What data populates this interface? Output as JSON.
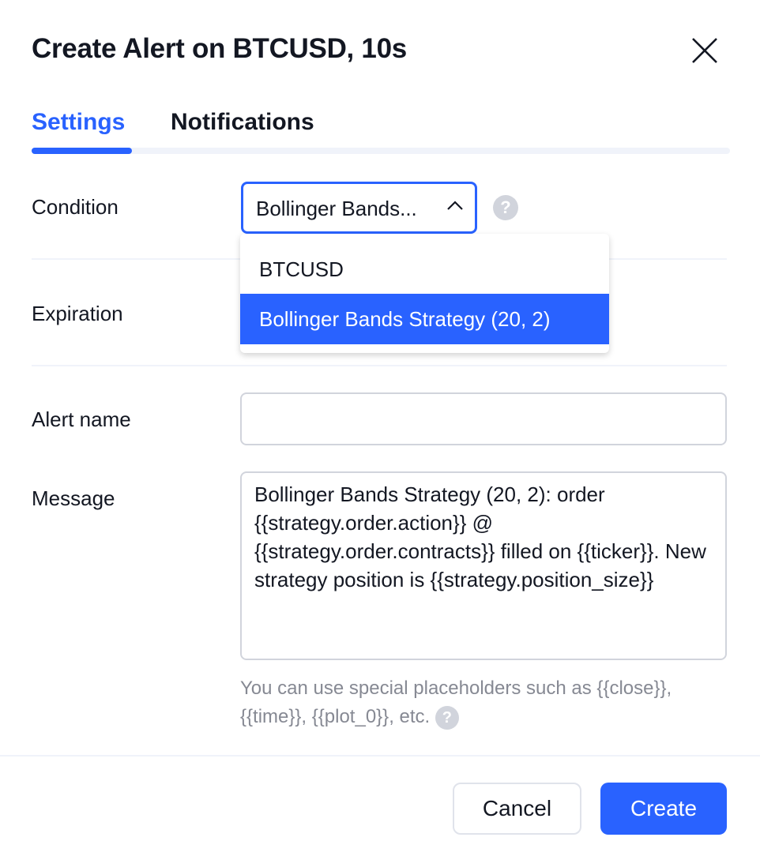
{
  "dialog": {
    "title": "Create Alert on BTCUSD, 10s",
    "close_icon": "close-icon"
  },
  "tabs": [
    {
      "label": "Settings",
      "active": true
    },
    {
      "label": "Notifications",
      "active": false
    }
  ],
  "accent_color": "#2962ff",
  "condition": {
    "label": "Condition",
    "selected": "Bollinger Bands...",
    "options": [
      "BTCUSD",
      "Bollinger Bands Strategy (20, 2)"
    ],
    "highlighted_option": "Bollinger Bands Strategy (20, 2)",
    "help": "?"
  },
  "expiration": {
    "label": "Expiration"
  },
  "alert_name": {
    "label": "Alert name",
    "value": ""
  },
  "message": {
    "label": "Message",
    "value": "Bollinger Bands Strategy (20, 2): order {{strategy.order.action}} @ {{strategy.order.contracts}} filled on {{ticker}}. New strategy position is {{strategy.position_size}}",
    "hint": "You can use special placeholders such as {{close}}, {{time}}, {{plot_0}}, etc.",
    "help": "?"
  },
  "footer": {
    "cancel": "Cancel",
    "create": "Create"
  }
}
